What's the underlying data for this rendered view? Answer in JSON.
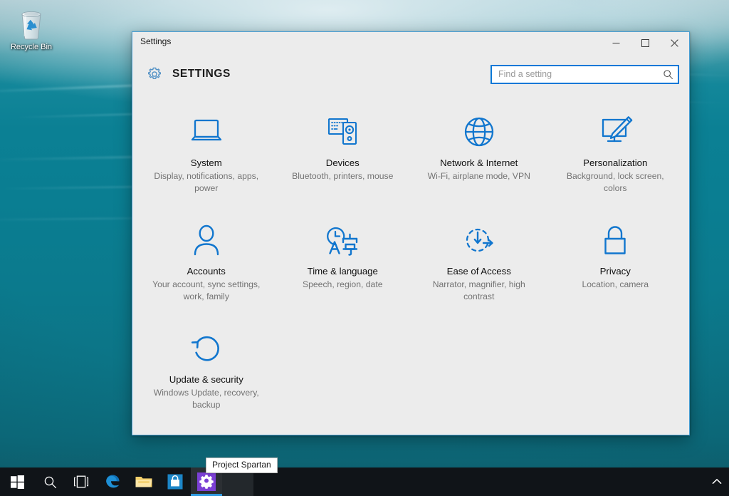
{
  "desktop": {
    "icons": [
      {
        "name": "recycle-bin",
        "label": "Recycle Bin"
      }
    ],
    "wallpaper_colors": {
      "water_deep": "#0a7e92",
      "water_surface": "#bcd7dd",
      "water_bottom": "#0f5f6d"
    }
  },
  "window": {
    "title": "Settings",
    "header_title": "SETTINGS",
    "header_icon": "gear-icon",
    "accent_color": "#0078d7",
    "border_color": "#4a9fd4",
    "background_color": "#ececec",
    "controls": {
      "minimize": "minimize-icon",
      "maximize": "maximize-icon",
      "close": "close-icon"
    }
  },
  "search": {
    "placeholder": "Find a setting",
    "value": "",
    "icon": "search-icon"
  },
  "tiles": [
    {
      "id": "system",
      "icon": "laptop-icon",
      "title": "System",
      "description": "Display, notifications, apps, power"
    },
    {
      "id": "devices",
      "icon": "keyboard-speaker-icon",
      "title": "Devices",
      "description": "Bluetooth, printers, mouse"
    },
    {
      "id": "network-internet",
      "icon": "globe-icon",
      "title": "Network & Internet",
      "description": "Wi-Fi, airplane mode, VPN"
    },
    {
      "id": "personalization",
      "icon": "monitor-brush-icon",
      "title": "Personalization",
      "description": "Background, lock screen, colors"
    },
    {
      "id": "accounts",
      "icon": "person-icon",
      "title": "Accounts",
      "description": "Your account, sync settings, work, family"
    },
    {
      "id": "time-language",
      "icon": "clock-language-icon",
      "title": "Time & language",
      "description": "Speech, region, date"
    },
    {
      "id": "ease-of-access",
      "icon": "ease-of-access-icon",
      "title": "Ease of Access",
      "description": "Narrator, magnifier, high contrast"
    },
    {
      "id": "privacy",
      "icon": "lock-icon",
      "title": "Privacy",
      "description": "Location, camera"
    },
    {
      "id": "update-security",
      "icon": "refresh-icon",
      "title": "Update & security",
      "description": "Windows Update, recovery, backup"
    }
  ],
  "tooltip": {
    "text": "Project Spartan"
  },
  "taskbar": {
    "background_color": "#101418",
    "active_indicator_color": "#2f9ae0",
    "items": [
      {
        "id": "start",
        "icon": "windows-logo-icon",
        "label": "Start"
      },
      {
        "id": "search",
        "icon": "search-icon",
        "label": "Search"
      },
      {
        "id": "task-view",
        "icon": "task-view-icon",
        "label": "Task View"
      },
      {
        "id": "edge",
        "icon": "edge-icon",
        "label": "Microsoft Edge"
      },
      {
        "id": "file-explorer",
        "icon": "folder-icon",
        "label": "File Explorer"
      },
      {
        "id": "store",
        "icon": "store-icon",
        "label": "Store"
      },
      {
        "id": "settings",
        "icon": "gear-icon",
        "label": "Settings",
        "active": true
      }
    ],
    "tray": {
      "chevron": "chevron-up-icon"
    }
  }
}
